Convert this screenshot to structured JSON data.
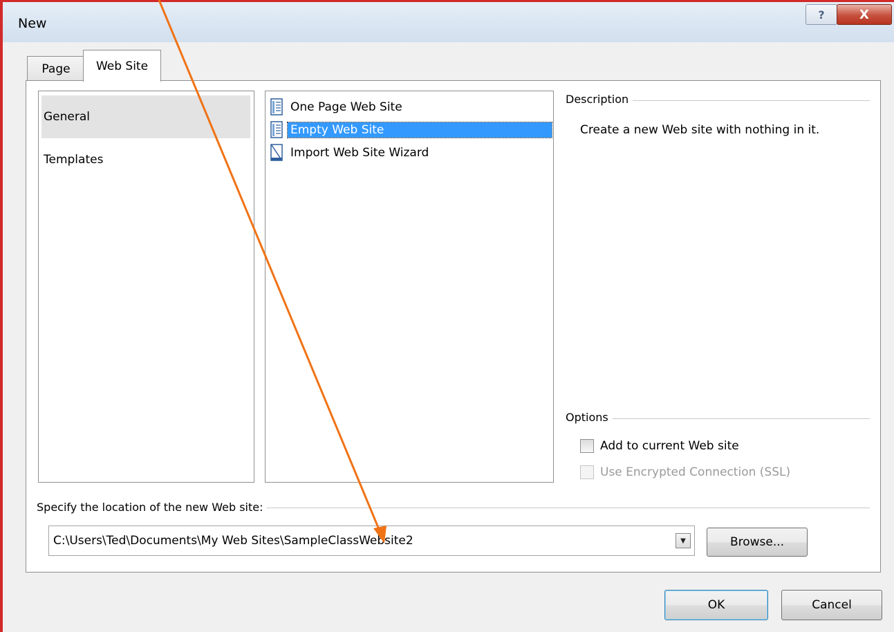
{
  "window": {
    "title": "New",
    "help_glyph": "?",
    "close_glyph": "X"
  },
  "tabs": [
    {
      "label": "Page"
    },
    {
      "label": "Web Site"
    }
  ],
  "categories": [
    {
      "label": "General"
    },
    {
      "label": "Templates"
    }
  ],
  "templates": [
    {
      "label": "One Page Web Site",
      "icon": "page-document-icon"
    },
    {
      "label": "Empty Web Site",
      "icon": "page-document-icon"
    },
    {
      "label": "Import Web Site Wizard",
      "icon": "import-wizard-icon"
    }
  ],
  "description": {
    "title": "Description",
    "text": "Create a new Web site with nothing in it."
  },
  "options": {
    "title": "Options",
    "add_to_current": "Add to current Web site",
    "use_ssl": "Use Encrypted Connection (SSL)"
  },
  "location": {
    "label": "Specify the location of the new Web site:",
    "value": "C:\\Users\\Ted\\Documents\\My Web Sites\\SampleClassWebsite2",
    "browse_label": "Browse..."
  },
  "buttons": {
    "ok": "OK",
    "cancel": "Cancel"
  },
  "colors": {
    "selection": "#3399ff",
    "annotation_arrow": "#f07316",
    "window_border": "#d22a2a"
  }
}
